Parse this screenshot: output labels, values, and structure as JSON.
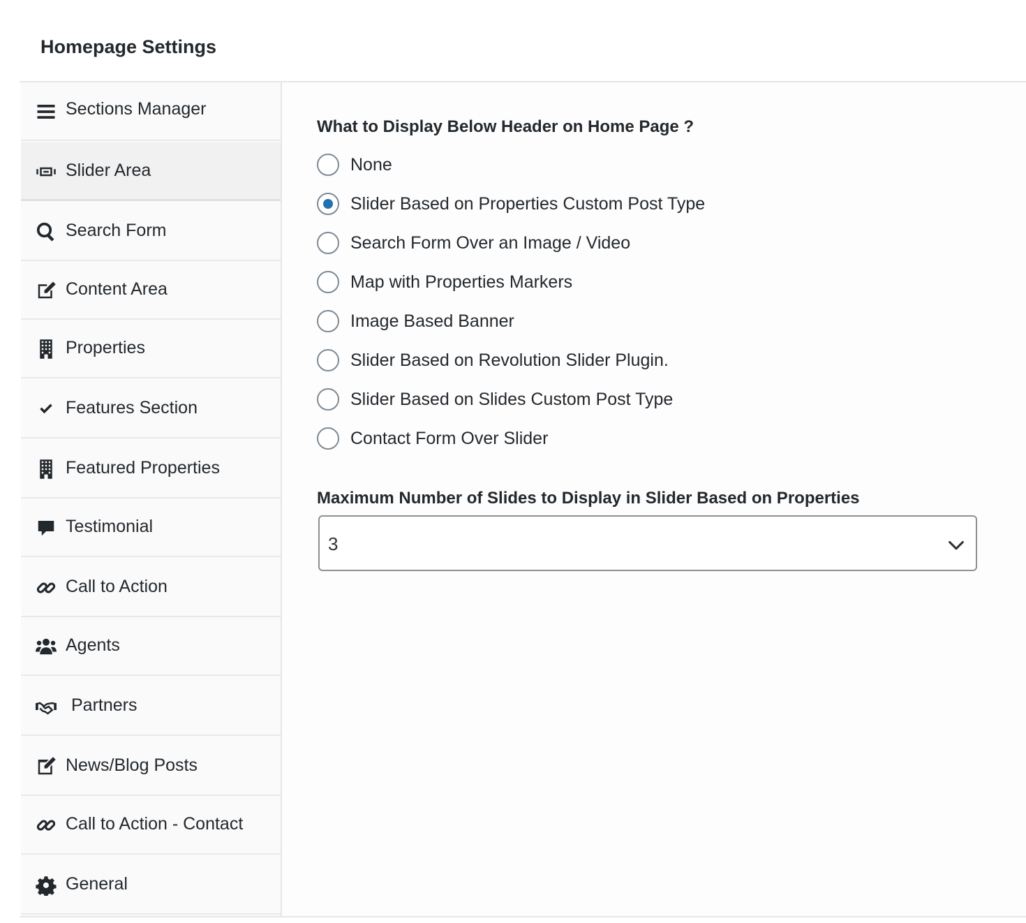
{
  "header": {
    "title": "Homepage Settings"
  },
  "sidebar": {
    "items": [
      {
        "label": "Sections Manager",
        "icon": "menu-icon"
      },
      {
        "label": "Slider Area",
        "icon": "slider-icon"
      },
      {
        "label": "Search Form",
        "icon": "search-icon"
      },
      {
        "label": "Content Area",
        "icon": "edit-icon"
      },
      {
        "label": "Properties",
        "icon": "building-icon"
      },
      {
        "label": "Features Section",
        "icon": "check-icon"
      },
      {
        "label": "Featured Properties",
        "icon": "building-icon"
      },
      {
        "label": "Testimonial",
        "icon": "comment-icon"
      },
      {
        "label": "Call to Action",
        "icon": "link-icon"
      },
      {
        "label": "Agents",
        "icon": "users-icon"
      },
      {
        "label": "Partners",
        "icon": "handshake-icon"
      },
      {
        "label": "News/Blog Posts",
        "icon": "post-icon"
      },
      {
        "label": "Call to Action - Contact",
        "icon": "link-icon"
      },
      {
        "label": "General",
        "icon": "gear-icon"
      }
    ],
    "active_index": 1
  },
  "main": {
    "question": "What to Display Below Header on Home Page ?",
    "options": [
      {
        "label": "None",
        "checked": false
      },
      {
        "label": "Slider Based on Properties Custom Post Type",
        "checked": true
      },
      {
        "label": "Search Form Over an Image / Video",
        "checked": false
      },
      {
        "label": "Map with Properties Markers",
        "checked": false
      },
      {
        "label": "Image Based Banner",
        "checked": false
      },
      {
        "label": "Slider Based on Revolution Slider Plugin.",
        "checked": false
      },
      {
        "label": "Slider Based on Slides Custom Post Type",
        "checked": false
      },
      {
        "label": "Contact Form Over Slider",
        "checked": false
      }
    ],
    "max_slides_label": "Maximum Number of Slides to Display in Slider Based on Properties",
    "max_slides_value": "3"
  },
  "colors": {
    "accent": "#2271b1",
    "text": "#23282d",
    "border": "#8c8f94"
  }
}
